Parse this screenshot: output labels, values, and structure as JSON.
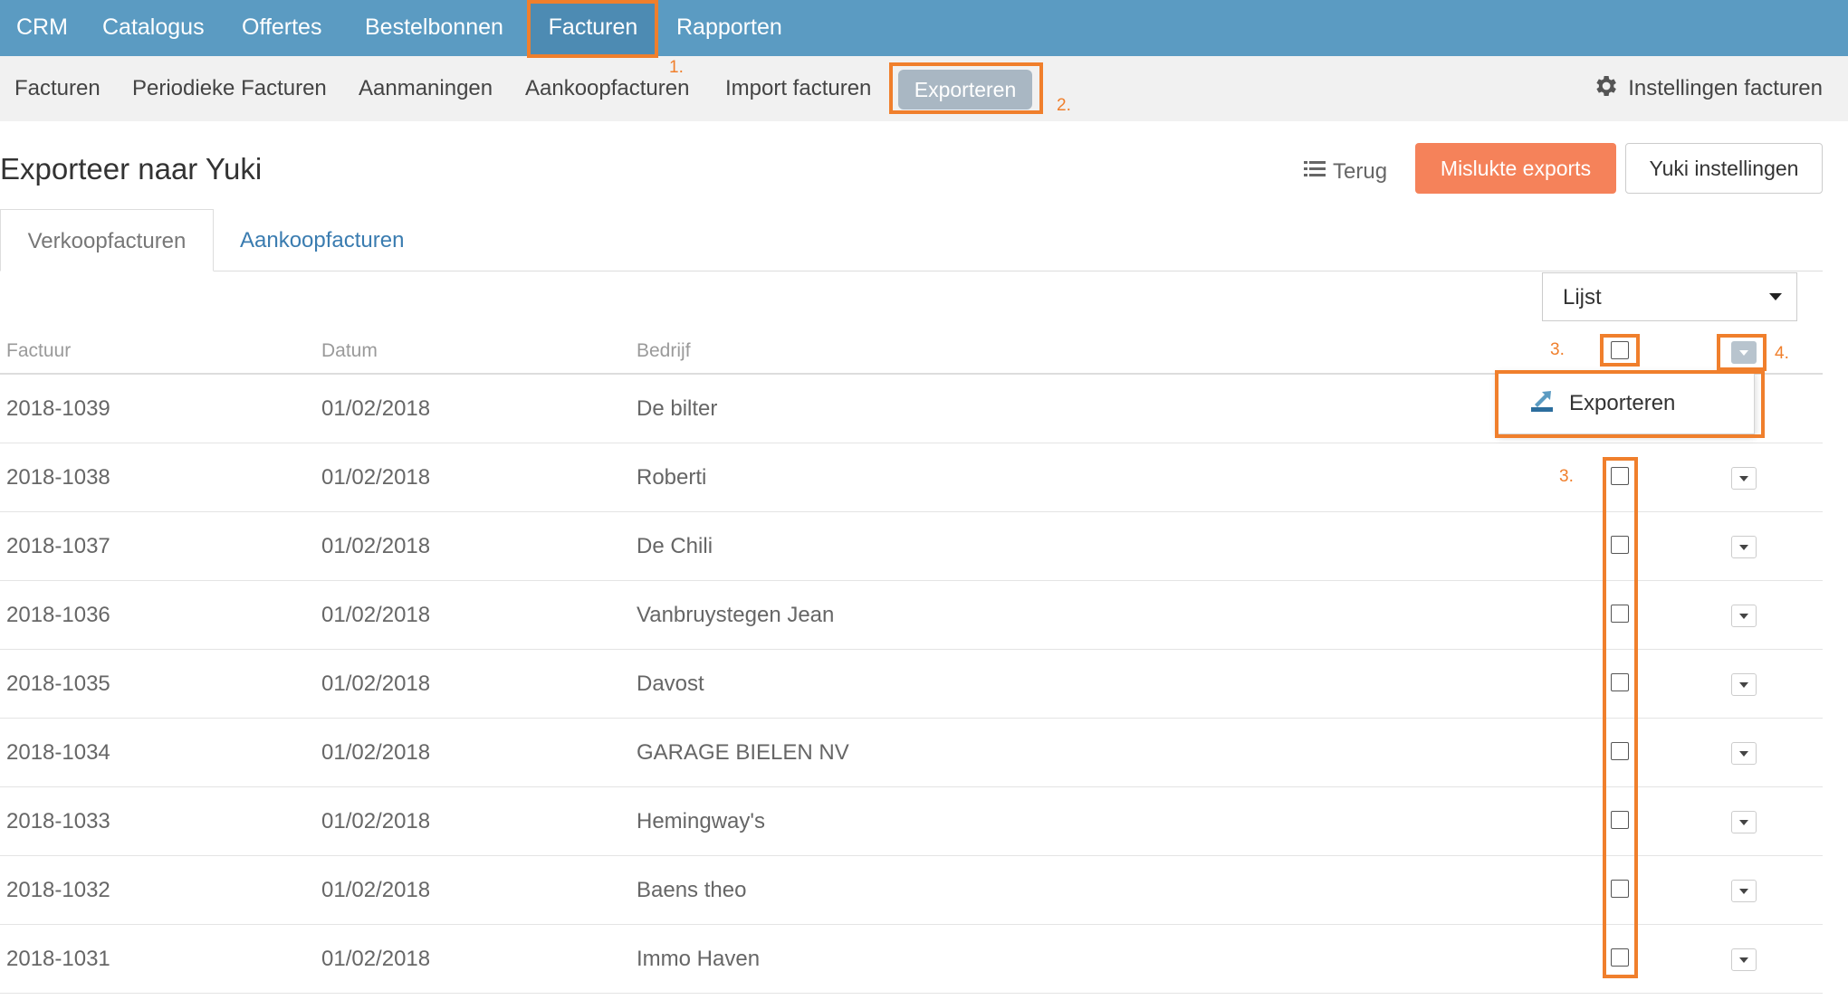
{
  "topnav": {
    "items": [
      {
        "label": "CRM"
      },
      {
        "label": "Catalogus"
      },
      {
        "label": "Offertes"
      },
      {
        "label": "Bestelbonnen"
      },
      {
        "label": "Facturen"
      },
      {
        "label": "Rapporten"
      }
    ],
    "active": "Facturen"
  },
  "subnav": {
    "items": [
      {
        "label": "Facturen"
      },
      {
        "label": "Periodieke Facturen"
      },
      {
        "label": "Aanmaningen"
      },
      {
        "label": "Aankoopfacturen"
      },
      {
        "label": "Import facturen"
      },
      {
        "label": "Exporteren"
      }
    ],
    "active": "Exporteren",
    "settings_label": "Instellingen facturen",
    "settings_icon": "gear-icon"
  },
  "page": {
    "title": "Exporteer naar Yuki",
    "back_label": "Terug",
    "back_icon": "list-icon",
    "failed_exports_label": "Mislukte exports",
    "yuki_settings_label": "Yuki instellingen"
  },
  "tabs": [
    {
      "label": "Verkoopfacturen",
      "active": true
    },
    {
      "label": "Aankoopfacturen",
      "active": false
    }
  ],
  "view_select": {
    "value": "Lijst"
  },
  "table": {
    "columns": [
      "Factuur",
      "Datum",
      "Bedrijf"
    ],
    "rows": [
      {
        "factuur": "2018-1039",
        "datum": "01/02/2018",
        "bedrijf": "De bilter"
      },
      {
        "factuur": "2018-1038",
        "datum": "01/02/2018",
        "bedrijf": "Roberti"
      },
      {
        "factuur": "2018-1037",
        "datum": "01/02/2018",
        "bedrijf": "De Chili"
      },
      {
        "factuur": "2018-1036",
        "datum": "01/02/2018",
        "bedrijf": "Vanbruystegen Jean"
      },
      {
        "factuur": "2018-1035",
        "datum": "01/02/2018",
        "bedrijf": "Davost"
      },
      {
        "factuur": "2018-1034",
        "datum": "01/02/2018",
        "bedrijf": "GARAGE BIELEN NV"
      },
      {
        "factuur": "2018-1033",
        "datum": "01/02/2018",
        "bedrijf": "Hemingway's"
      },
      {
        "factuur": "2018-1032",
        "datum": "01/02/2018",
        "bedrijf": "Baens theo"
      },
      {
        "factuur": "2018-1031",
        "datum": "01/02/2018",
        "bedrijf": "Immo Haven"
      }
    ]
  },
  "bulk_menu": {
    "item_label": "Exporteren",
    "item_icon": "export-icon"
  },
  "annotations": {
    "step1": "1.",
    "step2": "2.",
    "step3a": "3.",
    "step3b": "3.",
    "step4": "4."
  },
  "colors": {
    "topnav_bg": "#5b9bc2",
    "highlight": "#f07f2c",
    "failed_button": "#f5825a",
    "link": "#3a7cb0"
  }
}
